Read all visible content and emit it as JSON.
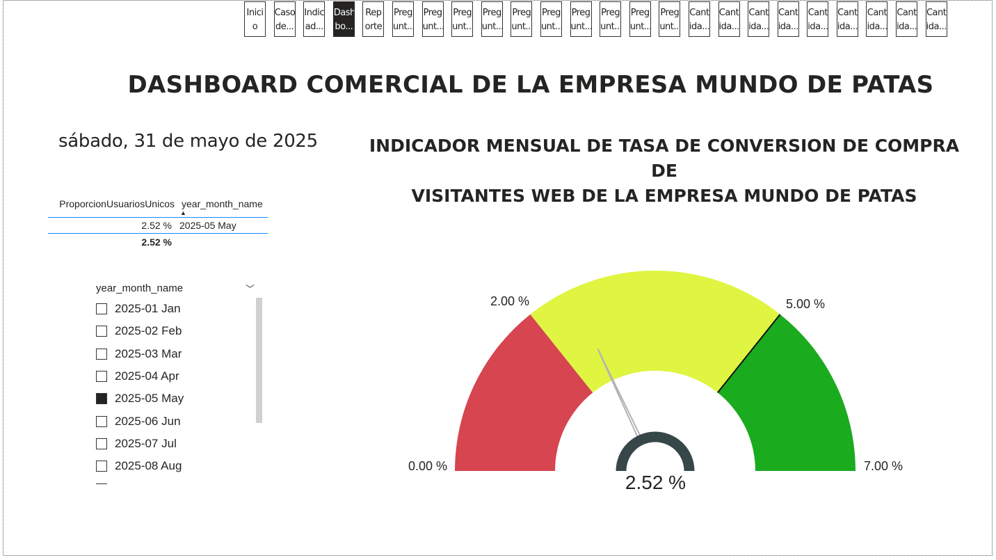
{
  "nav": {
    "buttons": [
      {
        "line1": "Inici",
        "line2": "o"
      },
      {
        "line1": "Caso",
        "line2": "de..."
      },
      {
        "line1": "Indic",
        "line2": "ad..."
      },
      {
        "line1": "Dash",
        "line2": "bo..."
      },
      {
        "line1": "Rep",
        "line2": "orte"
      },
      {
        "line1": "Preg",
        "line2": "unt..."
      },
      {
        "line1": "Preg",
        "line2": "unt..."
      },
      {
        "line1": "Preg",
        "line2": "unt..."
      },
      {
        "line1": "Preg",
        "line2": "unt..."
      },
      {
        "line1": "Preg",
        "line2": "unt..."
      },
      {
        "line1": "Preg",
        "line2": "unt..."
      },
      {
        "line1": "Preg",
        "line2": "unt..."
      },
      {
        "line1": "Preg",
        "line2": "unt..."
      },
      {
        "line1": "Preg",
        "line2": "unt..."
      },
      {
        "line1": "Preg",
        "line2": "unt..."
      },
      {
        "line1": "Cant",
        "line2": "ida..."
      },
      {
        "line1": "Cant",
        "line2": "ida..."
      },
      {
        "line1": "Cant",
        "line2": "ida..."
      },
      {
        "line1": "Cant",
        "line2": "ida..."
      },
      {
        "line1": "Cant",
        "line2": "ida..."
      },
      {
        "line1": "Cant",
        "line2": "ida..."
      },
      {
        "line1": "Cant",
        "line2": "ida..."
      },
      {
        "line1": "Cant",
        "line2": "ida..."
      },
      {
        "line1": "Cant",
        "line2": "ida..."
      }
    ],
    "active_index": 3
  },
  "main_title": "DASHBOARD COMERCIAL DE LA EMPRESA MUNDO DE PATAS",
  "date_card": "sábado, 31 de mayo de 2025",
  "table": {
    "headers": [
      "ProporcionUsuariosUnicos",
      "year_month_name"
    ],
    "rows": [
      [
        "2.52 %",
        "2025-05 May"
      ]
    ],
    "total": "2.52 %"
  },
  "slicer": {
    "title": "year_month_name",
    "items": [
      {
        "label": "2025-01 Jan",
        "checked": false
      },
      {
        "label": "2025-02 Feb",
        "checked": false
      },
      {
        "label": "2025-03 Mar",
        "checked": false
      },
      {
        "label": "2025-04 Apr",
        "checked": false
      },
      {
        "label": "2025-05 May",
        "checked": true
      },
      {
        "label": "2025-06 Jun",
        "checked": false
      },
      {
        "label": "2025-07 Jul",
        "checked": false
      },
      {
        "label": "2025-08 Aug",
        "checked": false
      }
    ]
  },
  "gauge": {
    "title_line1": "INDICADOR MENSUAL DE TASA DE CONVERSION DE COMPRA DE",
    "title_line2": "VISITANTES WEB DE LA EMPRESA  MUNDO DE PATAS",
    "min_label": "0.00 %",
    "max_label": "7.00 %",
    "band1_label": "2.00 %",
    "band2_label": "5.00 %",
    "value_label": "2.52 %",
    "min": 0,
    "max": 7,
    "band1": 2,
    "band2": 5,
    "value": 2.52,
    "colors": {
      "red": "#d64550",
      "yellow": "#dff542",
      "green": "#1aab1f",
      "center": "#374649",
      "needle": "#b3b3b3"
    }
  }
}
